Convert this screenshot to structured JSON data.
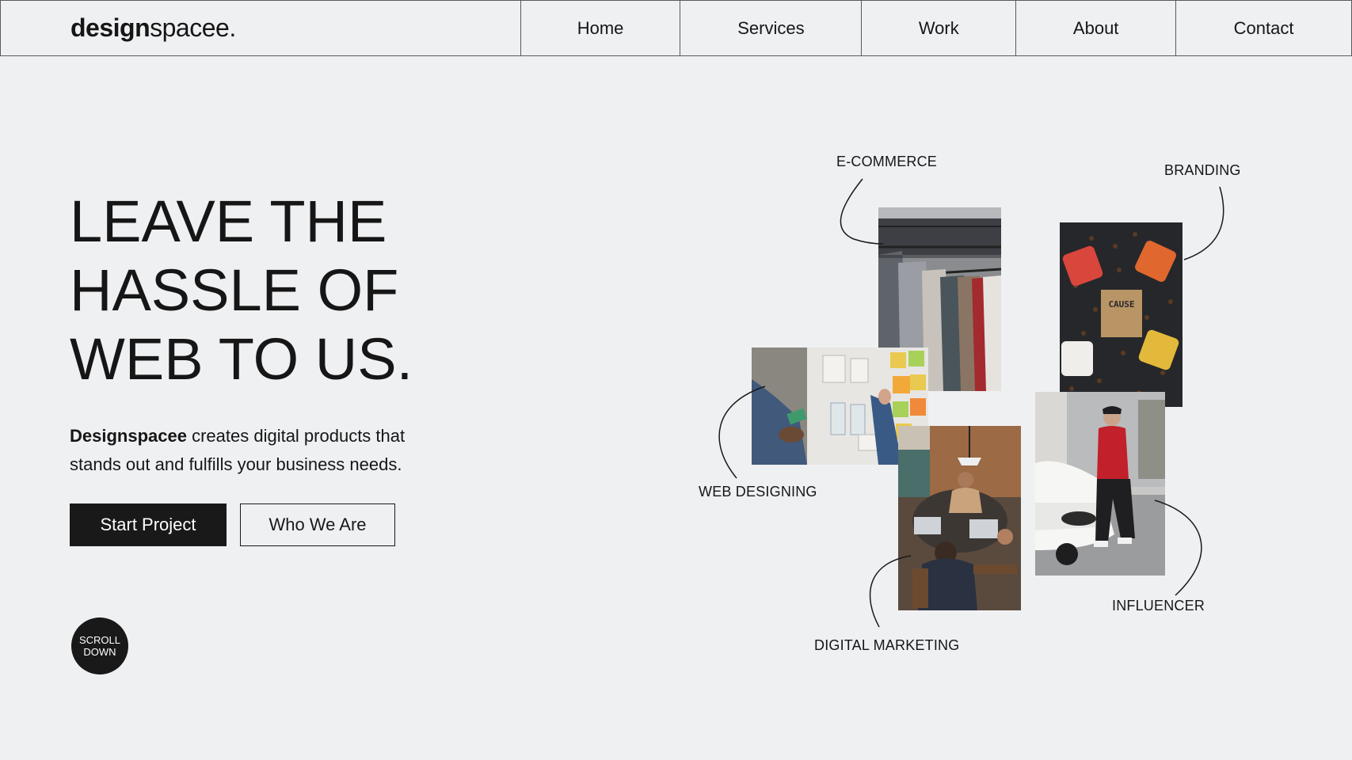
{
  "nav": {
    "logo_bold": "design",
    "logo_rest": "spacee.",
    "items": [
      "Home",
      "Services",
      "Work",
      "About",
      "Contact"
    ]
  },
  "hero": {
    "headline_lines": [
      "LEAVE THE",
      "HASSLE OF",
      "WEB TO US."
    ],
    "brand": "Designspacee",
    "description_rest": " creates digital products that stands out and fulfills your business needs.",
    "cta_primary": "Start Project",
    "cta_secondary": "Who We Are",
    "scroll_line1": "SCROLL",
    "scroll_line2": "DOWN"
  },
  "collage": {
    "labels": {
      "ecommerce": "E-COMMERCE",
      "branding": "BRANDING",
      "web_designing": "WEB DESIGNING",
      "digital_marketing": "DIGITAL MARKETING",
      "influencer": "INFLUENCER"
    },
    "branding_bag_text": "CAUSE"
  },
  "colors": {
    "background": "#eff0f2",
    "text": "#161616",
    "primary_button": "#191919"
  }
}
